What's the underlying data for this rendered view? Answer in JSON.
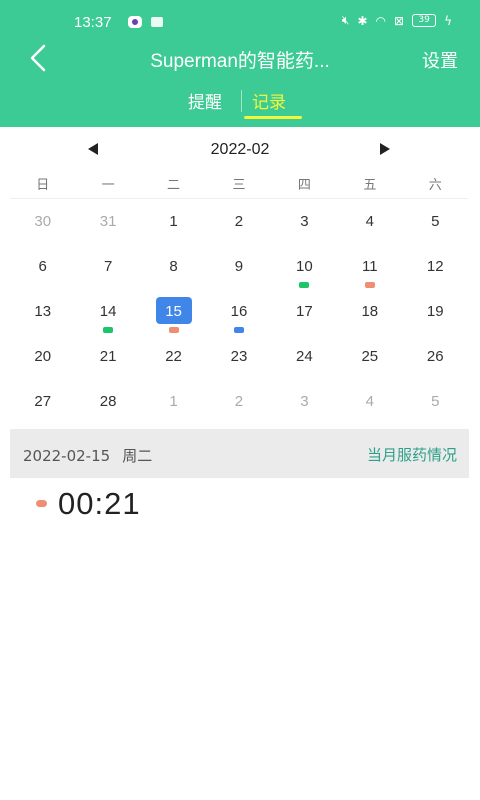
{
  "status_bar": {
    "time": "13:37",
    "battery": "39"
  },
  "header": {
    "title": "Superman的智能药...",
    "settings_label": "设置",
    "tabs": [
      {
        "label": "提醒",
        "active": false
      },
      {
        "label": "记录",
        "active": true
      }
    ]
  },
  "calendar": {
    "month_label": "2022-02",
    "weekdays": [
      "日",
      "一",
      "二",
      "三",
      "四",
      "五",
      "六"
    ],
    "weeks": [
      [
        {
          "d": "30",
          "other": true
        },
        {
          "d": "31",
          "other": true
        },
        {
          "d": "1"
        },
        {
          "d": "2"
        },
        {
          "d": "3"
        },
        {
          "d": "4"
        },
        {
          "d": "5"
        }
      ],
      [
        {
          "d": "6"
        },
        {
          "d": "7"
        },
        {
          "d": "8"
        },
        {
          "d": "9"
        },
        {
          "d": "10",
          "dot": "#1ec46a"
        },
        {
          "d": "11",
          "dot": "#f08e73"
        },
        {
          "d": "12"
        }
      ],
      [
        {
          "d": "13"
        },
        {
          "d": "14",
          "dot": "#1ec46a"
        },
        {
          "d": "15",
          "dot": "#f08e73",
          "selected": true
        },
        {
          "d": "16",
          "dot": "#3f86e8"
        },
        {
          "d": "17"
        },
        {
          "d": "18"
        },
        {
          "d": "19"
        }
      ],
      [
        {
          "d": "20"
        },
        {
          "d": "21"
        },
        {
          "d": "22"
        },
        {
          "d": "23"
        },
        {
          "d": "24"
        },
        {
          "d": "25"
        },
        {
          "d": "26"
        }
      ],
      [
        {
          "d": "27"
        },
        {
          "d": "28"
        },
        {
          "d": "1",
          "other": true
        },
        {
          "d": "2",
          "other": true
        },
        {
          "d": "3",
          "other": true
        },
        {
          "d": "4",
          "other": true
        },
        {
          "d": "5",
          "other": true
        }
      ]
    ]
  },
  "selected_day": {
    "date": "2022-02-15",
    "weekday": "周二",
    "monthly_link": "当月服药情况"
  },
  "records": [
    {
      "time": "00:21",
      "color": "#f08e73"
    }
  ],
  "colors": {
    "header": "#3dcb95",
    "active_tab": "#f4f63a",
    "selected_day": "#3f86e8",
    "link": "#2ea08a"
  }
}
